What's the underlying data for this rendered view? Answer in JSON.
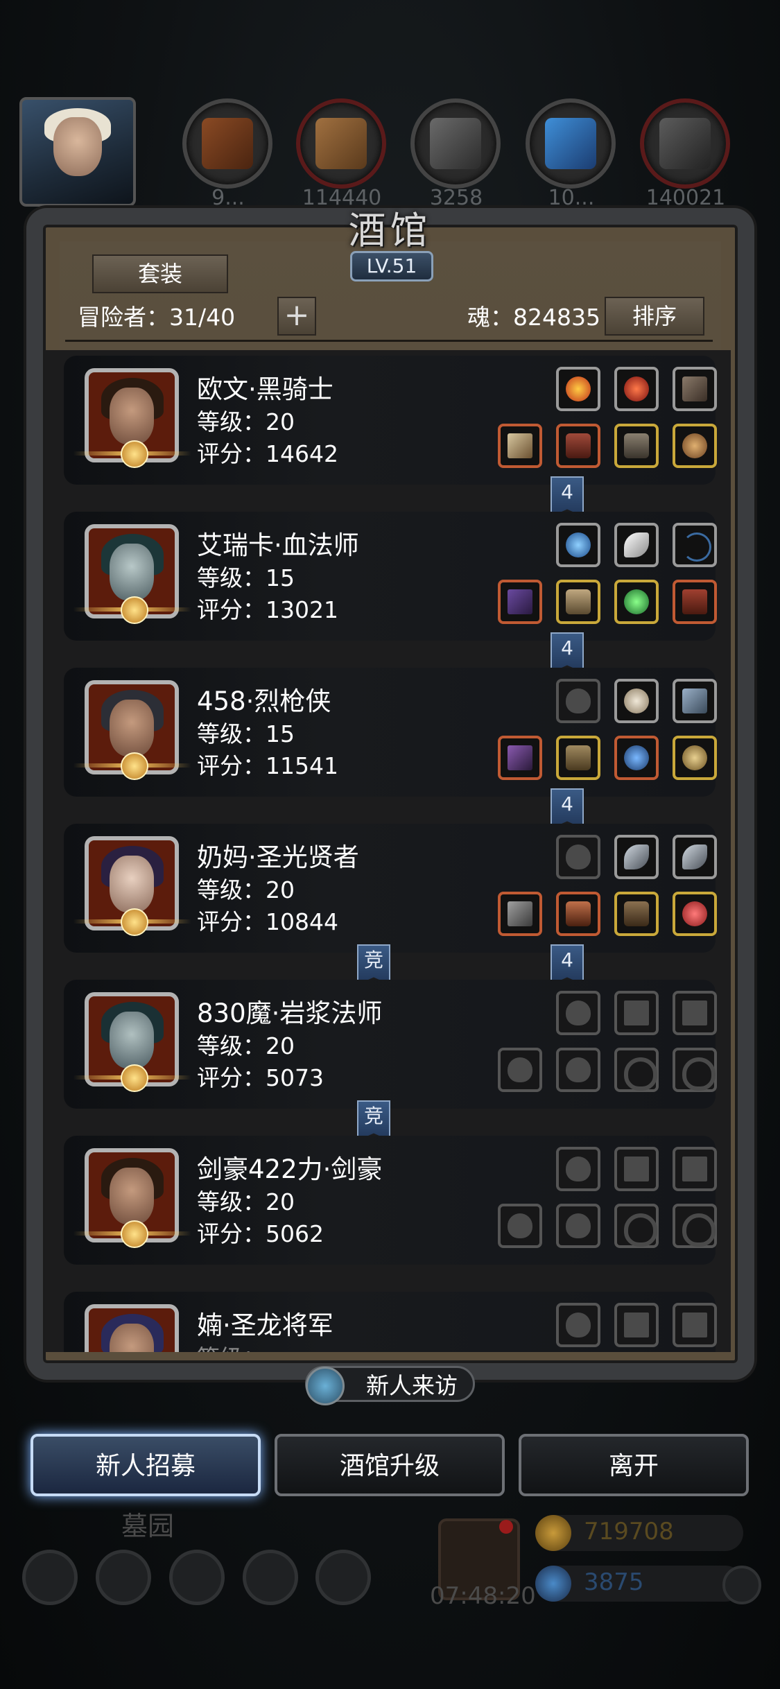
{
  "topbar": {
    "resources": [
      {
        "icon": "leather-icon",
        "amount": "9..."
      },
      {
        "icon": "wood-icon",
        "amount": "114440"
      },
      {
        "icon": "iron-icon",
        "amount": "3258"
      },
      {
        "icon": "crystal-icon",
        "amount": "10..."
      },
      {
        "icon": "ore-icon",
        "amount": "140021"
      }
    ]
  },
  "panel": {
    "title": "酒馆",
    "level": "LV.51",
    "set_button": "套装",
    "adventurers_label": "冒险者：31/40",
    "add_button": "+",
    "soul_label": "魂：824835",
    "sort_button": "排序"
  },
  "heroes": [
    {
      "name": "欧文·黑骑士",
      "level": "等级：20",
      "score": "评分：14642",
      "portrait": "dark-knight",
      "badge_right": "4",
      "badge_left": ""
    },
    {
      "name": "艾瑞卡·血法师",
      "level": "等级：15",
      "score": "评分：13021",
      "portrait": "blood-mage",
      "badge_right": "4",
      "badge_left": ""
    },
    {
      "name": "458·烈枪侠",
      "level": "等级：15",
      "score": "评分：11541",
      "portrait": "gunner",
      "badge_right": "4",
      "badge_left": ""
    },
    {
      "name": "奶妈·圣光贤者",
      "level": "等级：20",
      "score": "评分：10844",
      "portrait": "sage",
      "badge_right": "4",
      "badge_left": "竞"
    },
    {
      "name": "830魔·岩浆法师",
      "level": "等级：20",
      "score": "评分：5073",
      "portrait": "magma-mage",
      "badge_right": "",
      "badge_left": "竞"
    },
    {
      "name": "剑豪422力·剑豪",
      "level": "等级：20",
      "score": "评分：5062",
      "portrait": "swordsman",
      "badge_right": "",
      "badge_left": ""
    },
    {
      "name": "婻·圣龙将军",
      "level": "等级：...",
      "score": "",
      "portrait": "dragon-general",
      "badge_right": "",
      "badge_left": ""
    }
  ],
  "bottom": {
    "new_visitor": "新人来访",
    "recruit": "新人招募",
    "upgrade": "酒馆升级",
    "leave": "离开",
    "graveyard": "墓园",
    "timer": "07:48:20",
    "gold": "719708",
    "gems": "3875"
  },
  "colors": {
    "gold_border": "#c9a83a",
    "red_border": "#c05a33",
    "active_button": "#c6dbf5"
  }
}
